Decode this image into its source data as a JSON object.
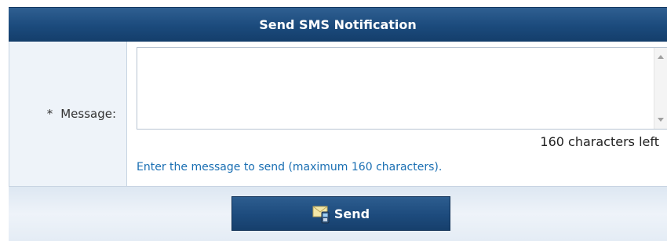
{
  "panel": {
    "title": "Send SMS Notification"
  },
  "message_field": {
    "required_marker": "*",
    "label": "Message:",
    "value": "",
    "chars_left": "160 characters left",
    "help": "Enter the message to send (maximum 160 characters)."
  },
  "footer": {
    "send_label": "Send",
    "send_icon": "sms-mail-phone-icon"
  },
  "colors": {
    "header_bg": "#1b4a7c",
    "help_text": "#1a6fb3",
    "label_bg": "#eef3f9"
  }
}
